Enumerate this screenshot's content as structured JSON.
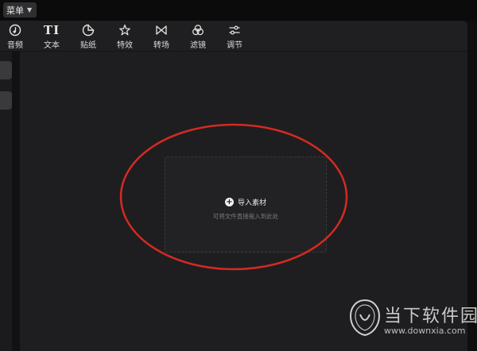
{
  "menu": {
    "label": "菜单"
  },
  "toolbar": {
    "tools": [
      {
        "label": "音频",
        "icon": "audio-icon"
      },
      {
        "label": "文本",
        "icon": "text-icon",
        "glyph": "TI"
      },
      {
        "label": "贴纸",
        "icon": "sticker-icon"
      },
      {
        "label": "特效",
        "icon": "effects-icon"
      },
      {
        "label": "转场",
        "icon": "transition-icon"
      },
      {
        "label": "滤镜",
        "icon": "filter-icon"
      },
      {
        "label": "调节",
        "icon": "adjust-icon"
      }
    ]
  },
  "media": {
    "import_label": "导入素材",
    "import_hint": "可将文件直接拖入到此处"
  },
  "watermark": {
    "title": "当下软件园",
    "url": "www.downxia.com"
  },
  "colors": {
    "annotation": "#d42a22",
    "background": "#1e1e20",
    "toolbar": "#1f1f21"
  }
}
